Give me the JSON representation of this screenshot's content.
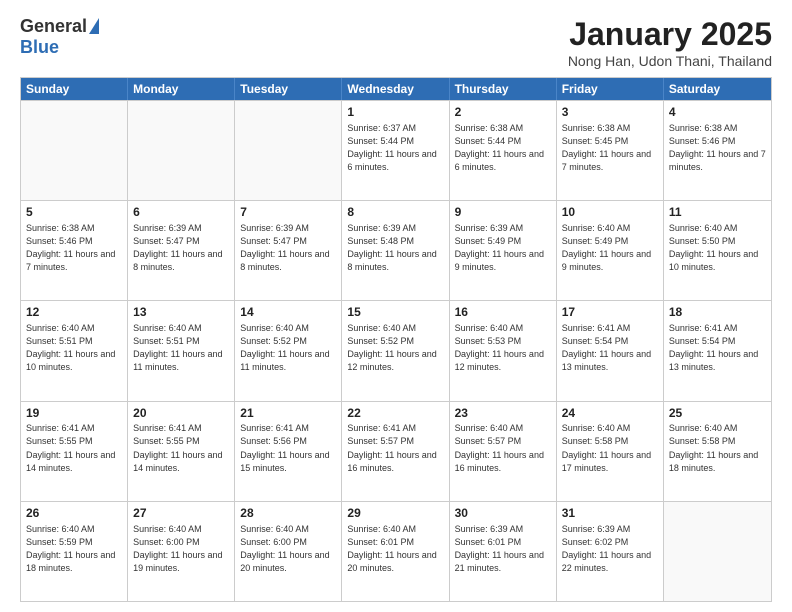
{
  "logo": {
    "general": "General",
    "blue": "Blue"
  },
  "title": "January 2025",
  "location": "Nong Han, Udon Thani, Thailand",
  "header": {
    "days": [
      "Sunday",
      "Monday",
      "Tuesday",
      "Wednesday",
      "Thursday",
      "Friday",
      "Saturday"
    ]
  },
  "weeks": [
    [
      {
        "day": "",
        "info": ""
      },
      {
        "day": "",
        "info": ""
      },
      {
        "day": "",
        "info": ""
      },
      {
        "day": "1",
        "info": "Sunrise: 6:37 AM\nSunset: 5:44 PM\nDaylight: 11 hours and 6 minutes."
      },
      {
        "day": "2",
        "info": "Sunrise: 6:38 AM\nSunset: 5:44 PM\nDaylight: 11 hours and 6 minutes."
      },
      {
        "day": "3",
        "info": "Sunrise: 6:38 AM\nSunset: 5:45 PM\nDaylight: 11 hours and 7 minutes."
      },
      {
        "day": "4",
        "info": "Sunrise: 6:38 AM\nSunset: 5:46 PM\nDaylight: 11 hours and 7 minutes."
      }
    ],
    [
      {
        "day": "5",
        "info": "Sunrise: 6:38 AM\nSunset: 5:46 PM\nDaylight: 11 hours and 7 minutes."
      },
      {
        "day": "6",
        "info": "Sunrise: 6:39 AM\nSunset: 5:47 PM\nDaylight: 11 hours and 8 minutes."
      },
      {
        "day": "7",
        "info": "Sunrise: 6:39 AM\nSunset: 5:47 PM\nDaylight: 11 hours and 8 minutes."
      },
      {
        "day": "8",
        "info": "Sunrise: 6:39 AM\nSunset: 5:48 PM\nDaylight: 11 hours and 8 minutes."
      },
      {
        "day": "9",
        "info": "Sunrise: 6:39 AM\nSunset: 5:49 PM\nDaylight: 11 hours and 9 minutes."
      },
      {
        "day": "10",
        "info": "Sunrise: 6:40 AM\nSunset: 5:49 PM\nDaylight: 11 hours and 9 minutes."
      },
      {
        "day": "11",
        "info": "Sunrise: 6:40 AM\nSunset: 5:50 PM\nDaylight: 11 hours and 10 minutes."
      }
    ],
    [
      {
        "day": "12",
        "info": "Sunrise: 6:40 AM\nSunset: 5:51 PM\nDaylight: 11 hours and 10 minutes."
      },
      {
        "day": "13",
        "info": "Sunrise: 6:40 AM\nSunset: 5:51 PM\nDaylight: 11 hours and 11 minutes."
      },
      {
        "day": "14",
        "info": "Sunrise: 6:40 AM\nSunset: 5:52 PM\nDaylight: 11 hours and 11 minutes."
      },
      {
        "day": "15",
        "info": "Sunrise: 6:40 AM\nSunset: 5:52 PM\nDaylight: 11 hours and 12 minutes."
      },
      {
        "day": "16",
        "info": "Sunrise: 6:40 AM\nSunset: 5:53 PM\nDaylight: 11 hours and 12 minutes."
      },
      {
        "day": "17",
        "info": "Sunrise: 6:41 AM\nSunset: 5:54 PM\nDaylight: 11 hours and 13 minutes."
      },
      {
        "day": "18",
        "info": "Sunrise: 6:41 AM\nSunset: 5:54 PM\nDaylight: 11 hours and 13 minutes."
      }
    ],
    [
      {
        "day": "19",
        "info": "Sunrise: 6:41 AM\nSunset: 5:55 PM\nDaylight: 11 hours and 14 minutes."
      },
      {
        "day": "20",
        "info": "Sunrise: 6:41 AM\nSunset: 5:55 PM\nDaylight: 11 hours and 14 minutes."
      },
      {
        "day": "21",
        "info": "Sunrise: 6:41 AM\nSunset: 5:56 PM\nDaylight: 11 hours and 15 minutes."
      },
      {
        "day": "22",
        "info": "Sunrise: 6:41 AM\nSunset: 5:57 PM\nDaylight: 11 hours and 16 minutes."
      },
      {
        "day": "23",
        "info": "Sunrise: 6:40 AM\nSunset: 5:57 PM\nDaylight: 11 hours and 16 minutes."
      },
      {
        "day": "24",
        "info": "Sunrise: 6:40 AM\nSunset: 5:58 PM\nDaylight: 11 hours and 17 minutes."
      },
      {
        "day": "25",
        "info": "Sunrise: 6:40 AM\nSunset: 5:58 PM\nDaylight: 11 hours and 18 minutes."
      }
    ],
    [
      {
        "day": "26",
        "info": "Sunrise: 6:40 AM\nSunset: 5:59 PM\nDaylight: 11 hours and 18 minutes."
      },
      {
        "day": "27",
        "info": "Sunrise: 6:40 AM\nSunset: 6:00 PM\nDaylight: 11 hours and 19 minutes."
      },
      {
        "day": "28",
        "info": "Sunrise: 6:40 AM\nSunset: 6:00 PM\nDaylight: 11 hours and 20 minutes."
      },
      {
        "day": "29",
        "info": "Sunrise: 6:40 AM\nSunset: 6:01 PM\nDaylight: 11 hours and 20 minutes."
      },
      {
        "day": "30",
        "info": "Sunrise: 6:39 AM\nSunset: 6:01 PM\nDaylight: 11 hours and 21 minutes."
      },
      {
        "day": "31",
        "info": "Sunrise: 6:39 AM\nSunset: 6:02 PM\nDaylight: 11 hours and 22 minutes."
      },
      {
        "day": "",
        "info": ""
      }
    ]
  ]
}
